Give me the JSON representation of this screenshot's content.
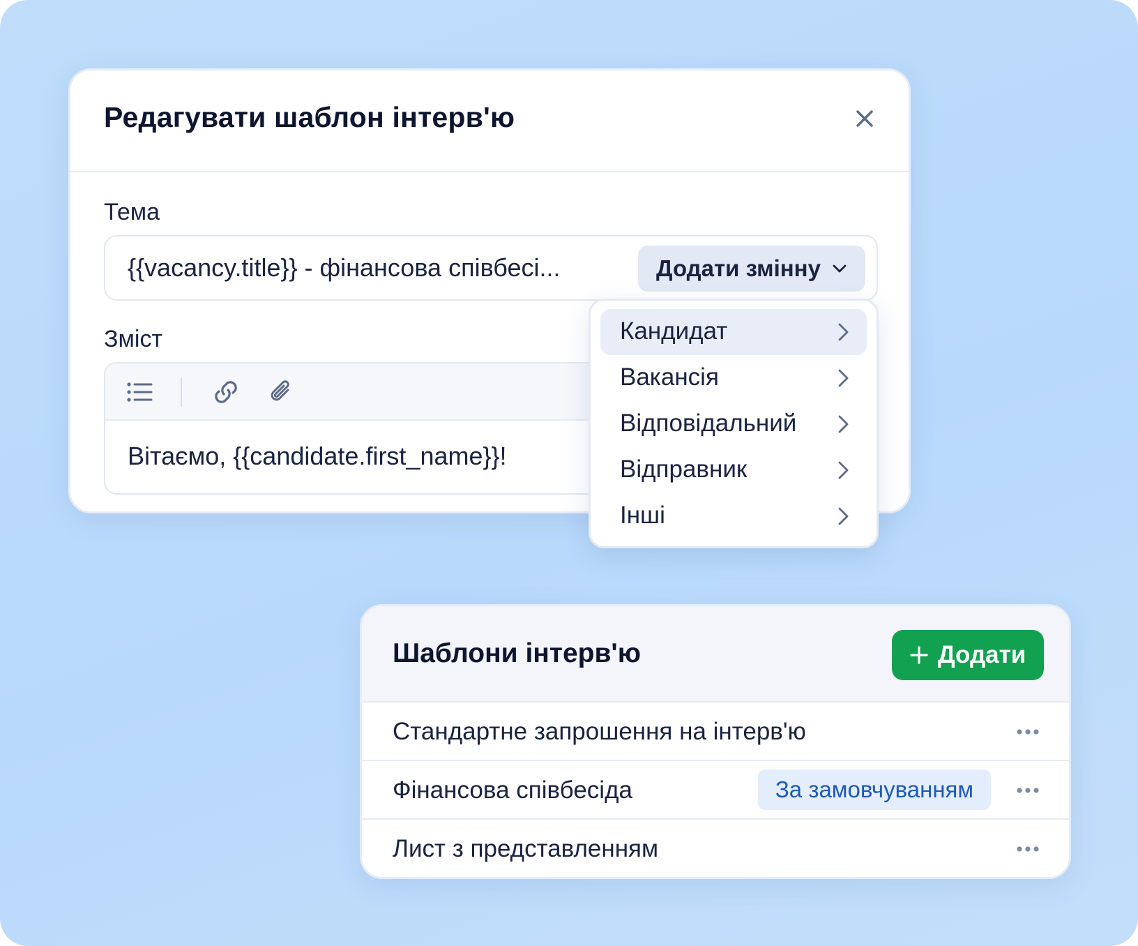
{
  "modal": {
    "title": "Редагувати шаблон інтерв'ю",
    "subject_label": "Тема",
    "subject_value": "{{vacancy.title}} - фінансова співбесі...",
    "add_variable_label": "Додати змінну",
    "content_label": "Зміст",
    "content_value": "Вітаємо, {{candidate.first_name}}!"
  },
  "dropdown": {
    "items": [
      {
        "label": "Кандидат"
      },
      {
        "label": "Вакансія"
      },
      {
        "label": "Відповідальний"
      },
      {
        "label": "Відправник"
      },
      {
        "label": "Інші"
      }
    ]
  },
  "templates": {
    "title": "Шаблони інтерв'ю",
    "add_label": "Додати",
    "rows": [
      {
        "name": "Стандартне запрошення на інтерв'ю",
        "badge": ""
      },
      {
        "name": "Фінансова співбесіда",
        "badge": "За замовчуванням"
      },
      {
        "name": "Лист з представленням",
        "badge": ""
      }
    ]
  },
  "colors": {
    "background": "#bfddfb",
    "primary_green": "#12a150",
    "badge_bg": "#e4edfb",
    "badge_text": "#1c5bb8",
    "text_dark": "#0d1530"
  }
}
